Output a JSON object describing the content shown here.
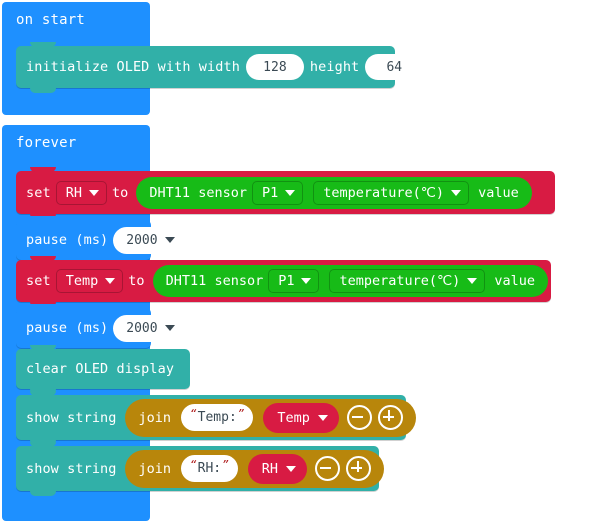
{
  "workspace": {
    "on_start": {
      "label": "on start",
      "init_oled": {
        "text_before": "initialize OLED with width",
        "width_value": "128",
        "text_middle": "height",
        "height_value": "64"
      }
    },
    "forever": {
      "label": "forever",
      "statements": [
        {
          "kind": "set",
          "set_label": "set",
          "variable": "RH",
          "to_label": "to",
          "value": {
            "sensor_label": "DHT11 sensor",
            "pin": "P1",
            "reading": "temperature(℃)",
            "value_label": "value"
          }
        },
        {
          "kind": "pause",
          "pause_label": "pause (ms)",
          "duration": "2000"
        },
        {
          "kind": "set",
          "set_label": "set",
          "variable": "Temp",
          "to_label": "to",
          "value": {
            "sensor_label": "DHT11 sensor",
            "pin": "P1",
            "reading": "temperature(℃)",
            "value_label": "value"
          }
        },
        {
          "kind": "pause",
          "pause_label": "pause (ms)",
          "duration": "2000"
        },
        {
          "kind": "clear",
          "label": "clear OLED display"
        },
        {
          "kind": "show_string",
          "show_label": "show string",
          "join_label": "join",
          "string_literal": "Temp: ",
          "variable": "Temp",
          "minus_icon": "minus-circle-icon",
          "plus_icon": "plus-circle-icon"
        },
        {
          "kind": "show_string",
          "show_label": "show string",
          "join_label": "join",
          "string_literal": "RH: ",
          "variable": "RH",
          "minus_icon": "minus-circle-icon",
          "plus_icon": "plus-circle-icon"
        }
      ]
    }
  },
  "colors": {
    "event_blue": "#1E90FF",
    "oled_teal": "#31B0A8",
    "variable_red": "#D81B43",
    "sensor_green": "#17BB17",
    "text_gold": "#B8860B",
    "field_white": "#FFFFFF"
  }
}
